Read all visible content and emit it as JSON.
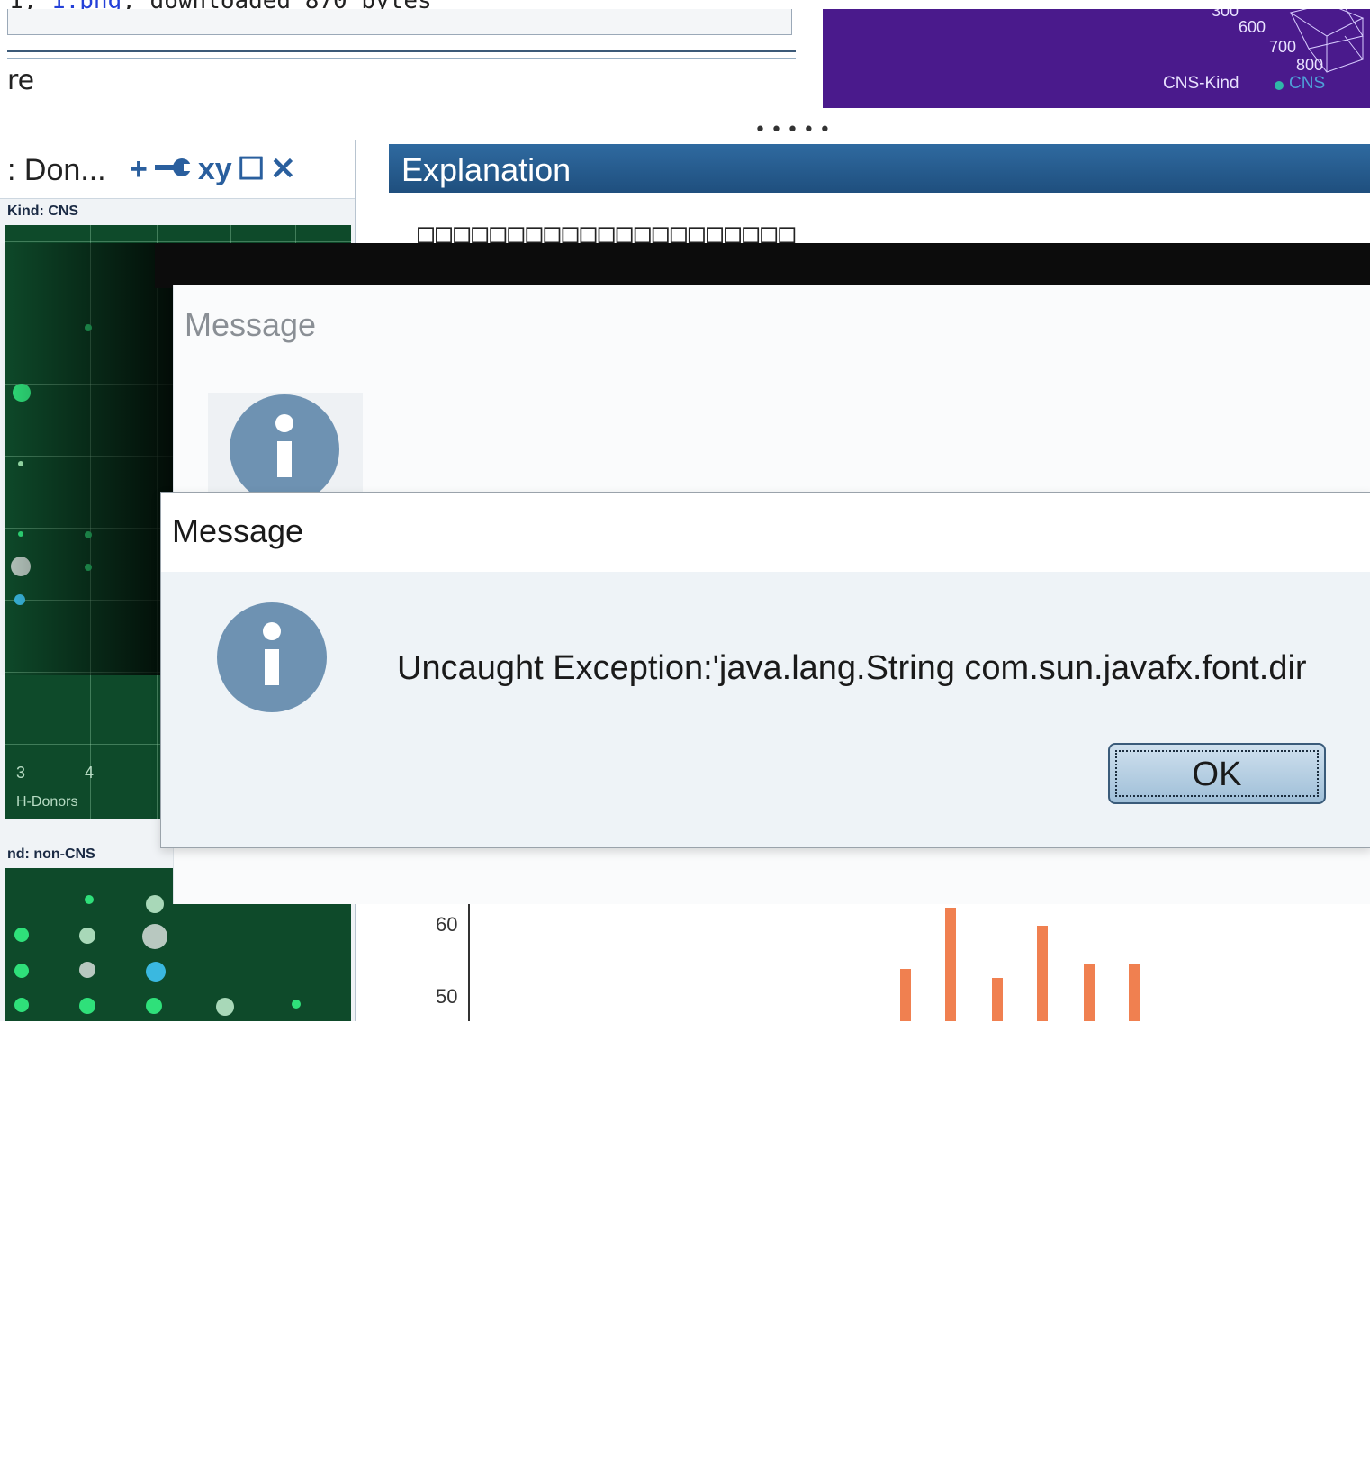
{
  "top_strip": {
    "prefix": "1, ",
    "link": "1.png",
    "suffix": ", downloaded 870 bytes"
  },
  "upper_panel": {
    "label": "re"
  },
  "purple_plot": {
    "ticks": [
      "300",
      "600",
      "700",
      "800"
    ],
    "legend_title": "CNS-Kind",
    "legend_item": "CNS",
    "background_color": "#4a1a8c"
  },
  "splitter": {
    "dots": "•••••"
  },
  "left_panel": {
    "title": ": Don...",
    "tools": {
      "add": "+",
      "wrench": "🔧",
      "xy": "xy",
      "maximize": "☐",
      "close": "✕"
    },
    "subheader_cns": "Kind: CNS",
    "x_ticks": [
      "3",
      "4"
    ],
    "x_label": "H-Donors",
    "subheader_noncns": "nd: non-CNS"
  },
  "explanation": {
    "title": "Explanation",
    "content": "□□□□□□□□□□□□□□□□□□□□□",
    "y_ticks": [
      "60",
      "50"
    ]
  },
  "dialog_back": {
    "title": "Message"
  },
  "dialog_front": {
    "title": "Message",
    "message": "Uncaught Exception:'java.lang.String com.sun.javafx.font.dir",
    "ok_label": "OK"
  },
  "colors": {
    "dialog_header": "#2f6aa0",
    "info_icon": "#6e92b2",
    "plot_bg": "#0e4a2a",
    "bar_color": "#f08050"
  }
}
